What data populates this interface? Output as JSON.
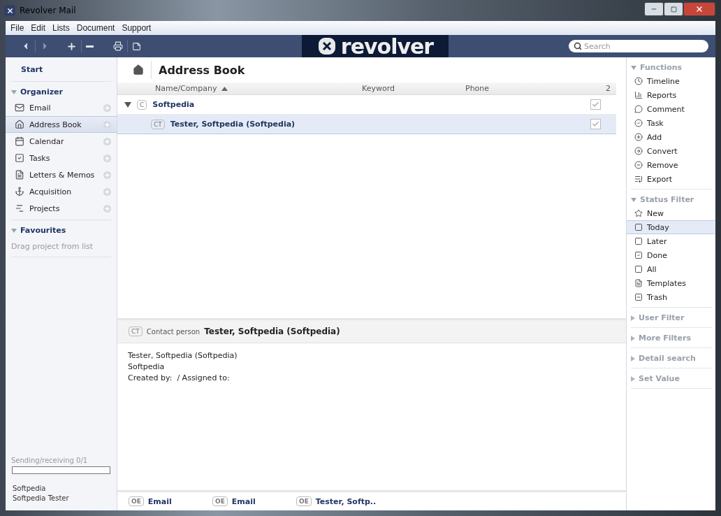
{
  "window": {
    "title": "Revolver Mail"
  },
  "menu": [
    "File",
    "Edit",
    "Lists",
    "Document",
    "Support"
  ],
  "logo": "revolver",
  "search": {
    "placeholder": "Search"
  },
  "sidebar": {
    "start": "Start",
    "organizer": {
      "title": "Organizer",
      "expanded": true,
      "items": [
        {
          "label": "Email",
          "selected": false
        },
        {
          "label": "Address Book",
          "selected": true
        },
        {
          "label": "Calendar",
          "selected": false
        },
        {
          "label": "Tasks",
          "selected": false
        },
        {
          "label": "Letters & Memos",
          "selected": false
        },
        {
          "label": "Acquisition",
          "selected": false
        },
        {
          "label": "Projects",
          "selected": false
        }
      ]
    },
    "favourites": {
      "title": "Favourites",
      "expanded": true,
      "hint": "Drag project from list"
    },
    "sync": {
      "label": "Sending/receiving 0/1",
      "level": 0
    },
    "account": [
      "Softpedia",
      "Softpedia Tester"
    ]
  },
  "page": {
    "title": "Address Book"
  },
  "table": {
    "columns": [
      "Name/Company",
      "Keyword",
      "Phone"
    ],
    "count": "2",
    "rows": [
      {
        "tag": "C",
        "name": "Softpedia",
        "expanded": true,
        "selected": false,
        "checked": true,
        "children": [
          {
            "tag": "CT",
            "name": "Tester, Softpedia (Softpedia)",
            "selected": true,
            "checked": true
          }
        ]
      }
    ]
  },
  "detail": {
    "tag": "CT",
    "type": "Contact person",
    "name": "Tester, Softpedia (Softpedia)",
    "lines": [
      "Tester, Softpedia (Softpedia)",
      "Softpedia",
      "Created by:  / Assigned to:"
    ]
  },
  "links": [
    {
      "tag": "OE",
      "label": "Email"
    },
    {
      "tag": "OE",
      "label": "Email"
    },
    {
      "tag": "OE",
      "label": "Tester, Softp.."
    }
  ],
  "right": {
    "sections": [
      {
        "title": "Functions",
        "expanded": true,
        "items": [
          {
            "label": "Timeline",
            "selected": false
          },
          {
            "label": "Reports",
            "selected": false
          },
          {
            "label": "Comment",
            "selected": false
          },
          {
            "label": "Task",
            "selected": false
          },
          {
            "label": "Add",
            "selected": false
          },
          {
            "label": "Convert",
            "selected": false
          },
          {
            "label": "Remove",
            "selected": false
          },
          {
            "label": "Export",
            "selected": false
          }
        ]
      },
      {
        "title": "Status Filter",
        "expanded": true,
        "items": [
          {
            "label": "New",
            "selected": false
          },
          {
            "label": "Today",
            "selected": true
          },
          {
            "label": "Later",
            "selected": false
          },
          {
            "label": "Done",
            "selected": false
          },
          {
            "label": "All",
            "selected": false
          },
          {
            "label": "Templates",
            "selected": false
          },
          {
            "label": "Trash",
            "selected": false
          }
        ]
      },
      {
        "title": "User Filter",
        "expanded": false
      },
      {
        "title": "More Filters",
        "expanded": false
      },
      {
        "title": "Detail search",
        "expanded": false
      },
      {
        "title": "Set Value",
        "expanded": false
      }
    ]
  }
}
